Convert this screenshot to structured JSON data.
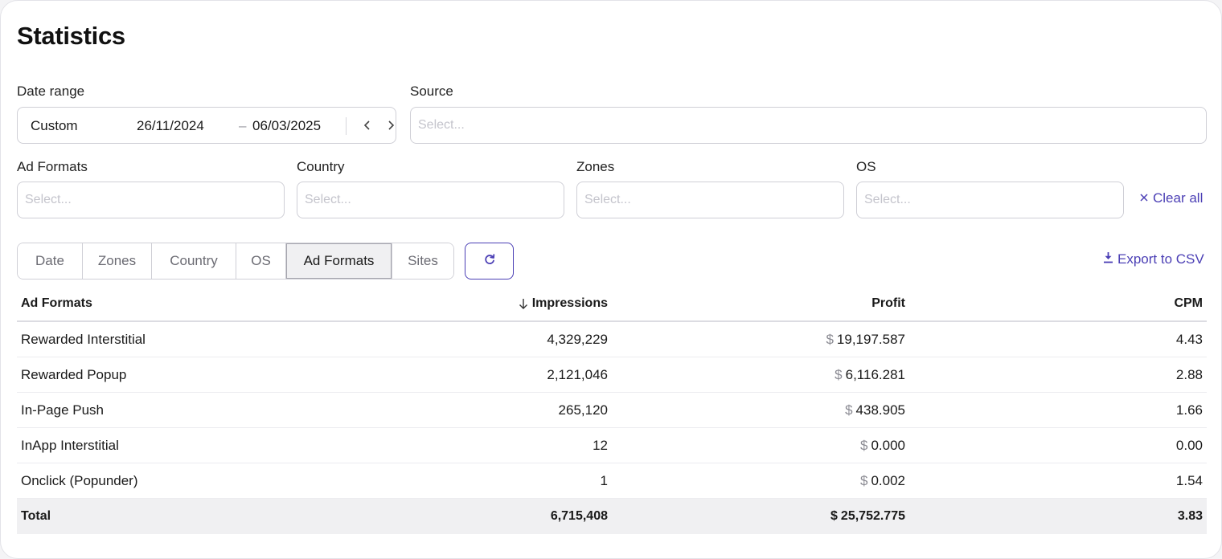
{
  "page": {
    "title": "Statistics"
  },
  "filters": {
    "date_range": {
      "label": "Date range",
      "preset": "Custom",
      "start": "26/11/2024",
      "separator": "–",
      "end": "06/03/2025"
    },
    "source": {
      "label": "Source",
      "placeholder": "Select..."
    },
    "ad_formats": {
      "label": "Ad Formats",
      "placeholder": "Select..."
    },
    "country": {
      "label": "Country",
      "placeholder": "Select..."
    },
    "zones": {
      "label": "Zones",
      "placeholder": "Select..."
    },
    "os": {
      "label": "OS",
      "placeholder": "Select..."
    },
    "clear_all": "Clear all"
  },
  "group_by": {
    "tabs": [
      {
        "label": "Date"
      },
      {
        "label": "Zones"
      },
      {
        "label": "Country"
      },
      {
        "label": "OS"
      },
      {
        "label": "Ad Formats",
        "active": true
      },
      {
        "label": "Sites"
      }
    ]
  },
  "export": {
    "label": "Export to CSV"
  },
  "table": {
    "columns": [
      "Ad Formats",
      "Impressions",
      "Profit",
      "CPM"
    ],
    "sort": {
      "column": "Impressions",
      "direction": "desc"
    },
    "currency_symbol": "$",
    "rows": [
      {
        "name": "Rewarded Interstitial",
        "impressions": "4,329,229",
        "profit": "19,197.587",
        "cpm": "4.43"
      },
      {
        "name": "Rewarded Popup",
        "impressions": "2,121,046",
        "profit": "6,116.281",
        "cpm": "2.88"
      },
      {
        "name": "In-Page Push",
        "impressions": "265,120",
        "profit": "438.905",
        "cpm": "1.66"
      },
      {
        "name": "InApp Interstitial",
        "impressions": "12",
        "profit": "0.000",
        "cpm": "0.00"
      },
      {
        "name": "Onclick (Popunder)",
        "impressions": "1",
        "profit": "0.002",
        "cpm": "1.54"
      }
    ],
    "total": {
      "name": "Total",
      "impressions": "6,715,408",
      "profit": "25,752.775",
      "cpm": "3.83"
    }
  },
  "colors": {
    "accent": "#4b3fb5",
    "border": "#cfcfd6",
    "placeholder": "#c4c4cc",
    "total_bg": "#f0f0f2"
  }
}
